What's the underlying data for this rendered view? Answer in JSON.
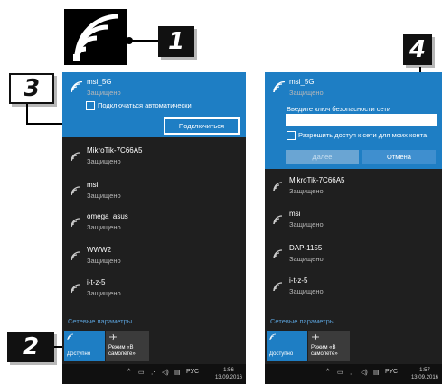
{
  "callouts": [
    "1",
    "2",
    "3",
    "4"
  ],
  "left_panel": {
    "selected": {
      "name": "msi_5G",
      "status": "Защищено",
      "auto_connect": "Подключаться автоматически",
      "connect_button": "Подключиться"
    },
    "networks": [
      {
        "name": "MikroTik-7C66A5",
        "status": "Защищено"
      },
      {
        "name": "msi",
        "status": "Защищено"
      },
      {
        "name": "omega_asus",
        "status": "Защищено"
      },
      {
        "name": "WWW2",
        "status": "Защищено"
      },
      {
        "name": "i-t-z-5",
        "status": "Защищено"
      }
    ],
    "network_settings": "Сетевые параметры",
    "tiles": [
      {
        "label": "Доступно",
        "icon": "wifi-icon",
        "active": true
      },
      {
        "label_line1": "Режим «В",
        "label_line2": "самолете»",
        "icon": "airplane-icon",
        "active": false
      }
    ],
    "taskbar": {
      "lang": "РУС",
      "time": "1:56",
      "date": "13.09.2016"
    }
  },
  "right_panel": {
    "selected": {
      "name": "msi_5G",
      "status": "Защищено",
      "key_prompt": "Введите ключ безопасности сети",
      "share_label": "Разрешить доступ к сети для моих конта",
      "next_button": "Далее",
      "cancel_button": "Отмена"
    },
    "networks": [
      {
        "name": "MikroTik-7C66A5",
        "status": "Защищено"
      },
      {
        "name": "msi",
        "status": "Защищено"
      },
      {
        "name": "DAP-1155",
        "status": "Защищено"
      },
      {
        "name": "i-t-z-5",
        "status": "Защищено"
      }
    ],
    "network_settings": "Сетевые параметры",
    "tiles": [
      {
        "label": "Доступно",
        "icon": "wifi-icon",
        "active": true
      },
      {
        "label_line1": "Режим «В",
        "label_line2": "самолете»",
        "icon": "airplane-icon",
        "active": false
      }
    ],
    "taskbar": {
      "lang": "РУС",
      "time": "1:57",
      "date": "13.09.2016"
    }
  },
  "colors": {
    "accent": "#1e7ec4",
    "panel": "#1f1f1f",
    "taskbar": "#101010",
    "link": "#5a9fd6"
  }
}
